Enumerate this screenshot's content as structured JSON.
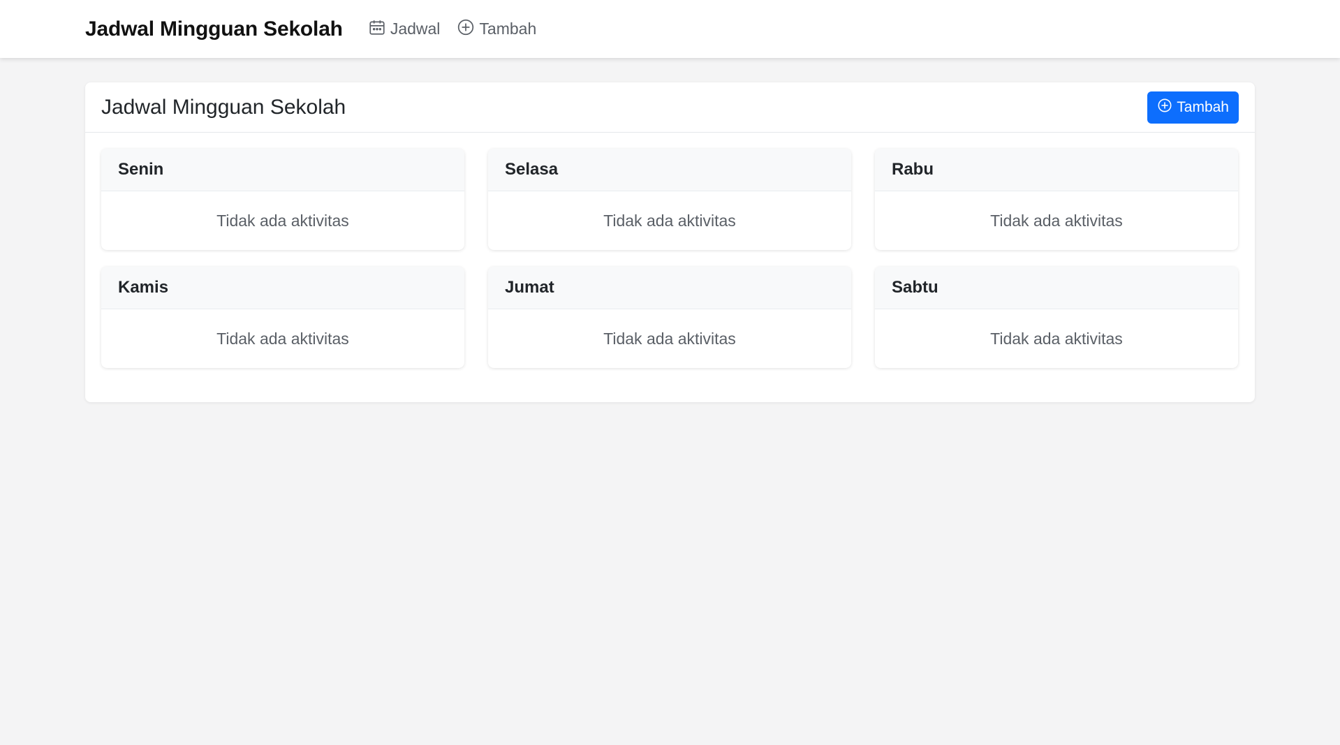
{
  "navbar": {
    "brand": "Jadwal Mingguan Sekolah",
    "links": [
      {
        "label": "Jadwal",
        "icon": "calendar-icon"
      },
      {
        "label": "Tambah",
        "icon": "plus-circle-icon"
      }
    ]
  },
  "panel": {
    "title": "Jadwal Mingguan Sekolah",
    "add_button_label": "Tambah",
    "add_button_icon": "plus-circle-icon",
    "accent_color": "#0d6efd"
  },
  "days": [
    {
      "name": "Senin",
      "empty_text": "Tidak ada aktivitas"
    },
    {
      "name": "Selasa",
      "empty_text": "Tidak ada aktivitas"
    },
    {
      "name": "Rabu",
      "empty_text": "Tidak ada aktivitas"
    },
    {
      "name": "Kamis",
      "empty_text": "Tidak ada aktivitas"
    },
    {
      "name": "Jumat",
      "empty_text": "Tidak ada aktivitas"
    },
    {
      "name": "Sabtu",
      "empty_text": "Tidak ada aktivitas"
    }
  ]
}
